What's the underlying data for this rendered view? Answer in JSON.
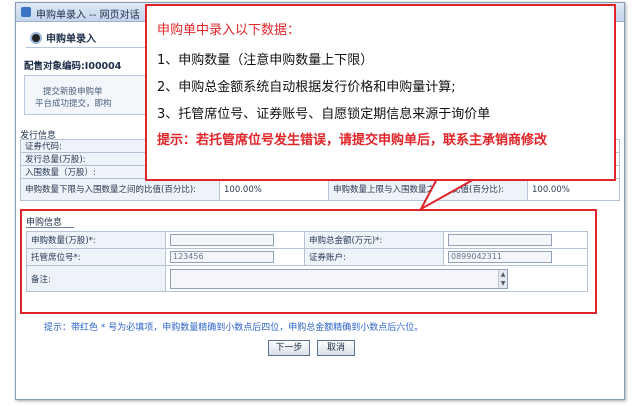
{
  "window": {
    "title": "申购单录入 -- 网页对话"
  },
  "page": {
    "heading": "申购单录入",
    "config_no_label": "配售对象编码:I00004",
    "notice_lines": [
      "提交新股申购单",
      "平台成功提交，即构"
    ]
  },
  "issue_info": {
    "section_title": "发行信息",
    "rows": [
      {
        "label": "证券代码:"
      },
      {
        "label": "发行总量(万股):"
      },
      {
        "label": "入围数量（万股）:"
      }
    ],
    "ratio_lower_label": "申购数量下限与入围数量之间的比值(百分比):",
    "ratio_lower_value": "100.00%",
    "ratio_upper_label": "申购数量上限与入围数量之间的比值(百分比):",
    "ratio_upper_value": "100.00%"
  },
  "subscription": {
    "section_title": "申购信息",
    "quantity_label": "申购数量(万股)*:",
    "quantity_value": "",
    "amount_label": "申购总金额(万元)*:",
    "amount_value": "",
    "seat_label": "托管席位号*:",
    "seat_value": "123456",
    "account_label": "证券账户:",
    "account_value": "0899042311",
    "remark_label": "备注:",
    "remark_value": ""
  },
  "hint": "提示：带红色 * 号为必填项，申购数量精确到小数点后四位，申购总金额精确到小数点后六位。",
  "buttons": {
    "next": "下一步",
    "cancel": "取消"
  },
  "callout": {
    "title": "申购单中录入以下数据：",
    "items": [
      "1、申购数量（注意申购数量上下限）",
      "2、申购总金额系统自动根据发行价格和申购量计算;",
      "3、托管席位号、证券账号、自愿锁定期信息来源于询价单"
    ],
    "tip": "提示：若托管席位号发生错误，请提交申购单后，联系主承销商修改"
  },
  "colors": {
    "accent_red": "#e0252a",
    "hint_blue": "#2c63c8",
    "titlebar": "#c3d4ea"
  }
}
